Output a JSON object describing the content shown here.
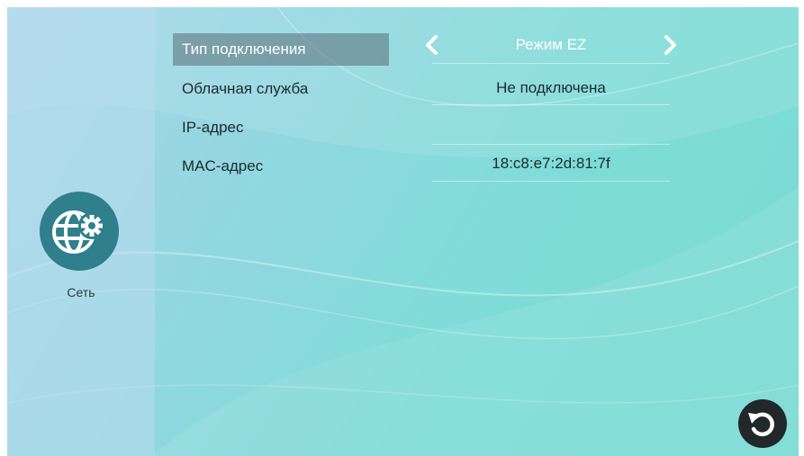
{
  "sidebar": {
    "category_label": "Сеть",
    "category_icon": "network-settings-icon"
  },
  "settings": [
    {
      "label": "Тип подключения",
      "value": "Режим EZ",
      "selected": true
    },
    {
      "label": "Облачная служба",
      "value": "Не подключена",
      "selected": false
    },
    {
      "label": "IP-адрес",
      "value": "",
      "selected": false
    },
    {
      "label": "MAC-адрес",
      "value": "18:c8:e7:2d:81:7f",
      "selected": false
    }
  ],
  "controls": {
    "prev_icon": "chevron-left-icon",
    "next_icon": "chevron-right-icon",
    "back_icon": "undo-icon"
  },
  "colors": {
    "icon_background": "#2f7f8d",
    "back_button": "#22272a",
    "selected_row": "#5a6e78"
  }
}
